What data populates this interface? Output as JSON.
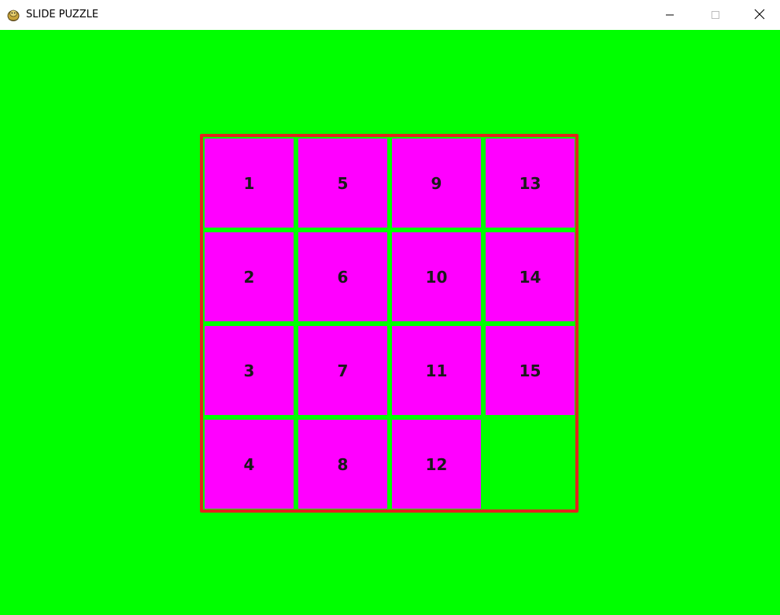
{
  "window": {
    "title": "SLIDE PUZZLE",
    "controls": {
      "minimize": "minimize",
      "maximize": "maximize",
      "close": "close"
    }
  },
  "colors": {
    "background": "#00ff00",
    "tile": "#ff00ff",
    "border": "#e1261c",
    "text": "#1a1a1a"
  },
  "board": {
    "size": 4,
    "tiles": [
      {
        "label": "1",
        "row": 0,
        "col": 0
      },
      {
        "label": "5",
        "row": 0,
        "col": 1
      },
      {
        "label": "9",
        "row": 0,
        "col": 2
      },
      {
        "label": "13",
        "row": 0,
        "col": 3
      },
      {
        "label": "2",
        "row": 1,
        "col": 0
      },
      {
        "label": "6",
        "row": 1,
        "col": 1
      },
      {
        "label": "10",
        "row": 1,
        "col": 2
      },
      {
        "label": "14",
        "row": 1,
        "col": 3
      },
      {
        "label": "3",
        "row": 2,
        "col": 0
      },
      {
        "label": "7",
        "row": 2,
        "col": 1
      },
      {
        "label": "11",
        "row": 2,
        "col": 2
      },
      {
        "label": "15",
        "row": 2,
        "col": 3
      },
      {
        "label": "4",
        "row": 3,
        "col": 0
      },
      {
        "label": "8",
        "row": 3,
        "col": 1
      },
      {
        "label": "12",
        "row": 3,
        "col": 2
      }
    ],
    "empty": {
      "row": 3,
      "col": 3
    }
  }
}
